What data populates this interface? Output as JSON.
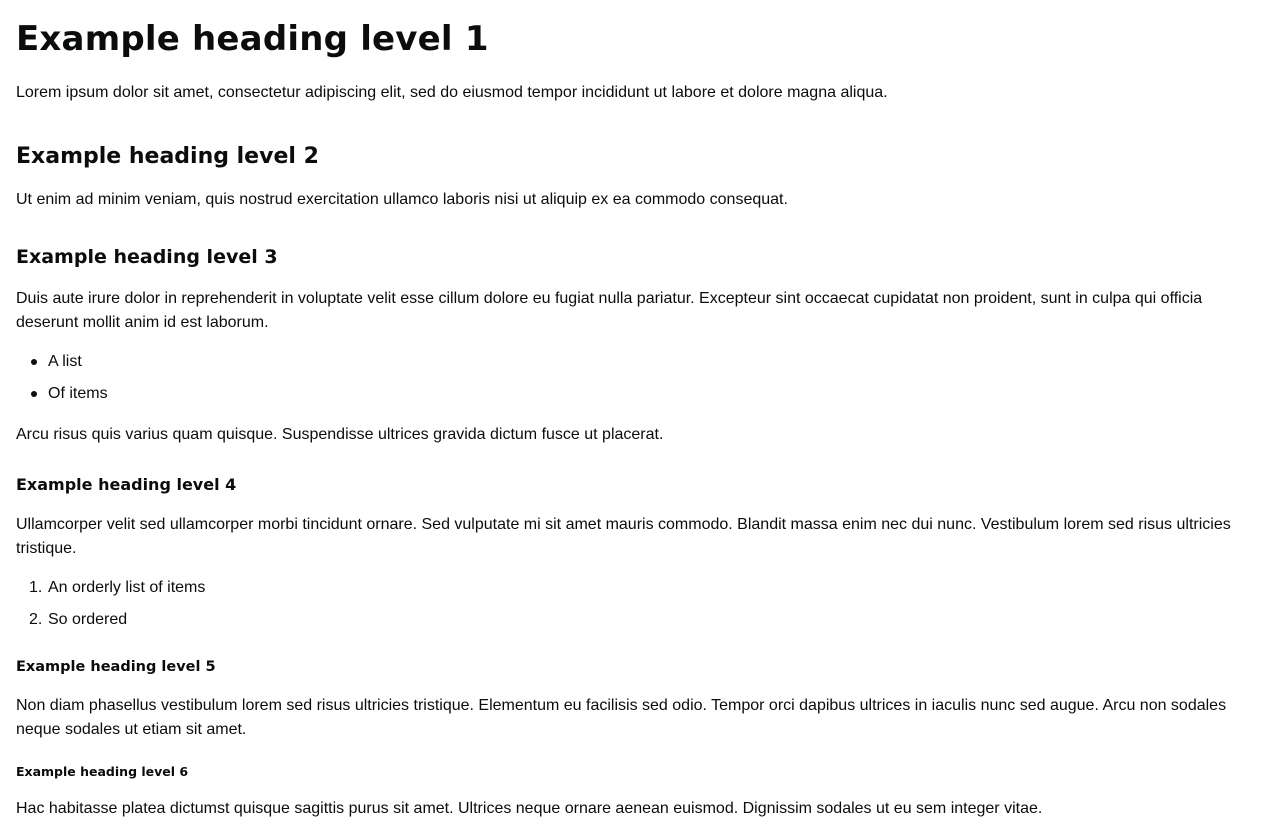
{
  "headings": {
    "h1": "Example heading level 1",
    "h2": "Example heading level 2",
    "h3": "Example heading level 3",
    "h4": "Example heading level 4",
    "h5": "Example heading level 5",
    "h6": "Example heading level 6"
  },
  "paragraphs": {
    "p1": "Lorem ipsum dolor sit amet, consectetur adipiscing elit, sed do eiusmod tempor incididunt ut labore et dolore magna aliqua.",
    "p2": "Ut enim ad minim veniam, quis nostrud exercitation ullamco laboris nisi ut aliquip ex ea commodo consequat.",
    "p3": "Duis aute irure dolor in reprehenderit in voluptate velit esse cillum dolore eu fugiat nulla pariatur. Excepteur sint occaecat cupidatat non proident, sunt in culpa qui officia deserunt mollit anim id est laborum.",
    "p4": "Arcu risus quis varius quam quisque. Suspendisse ultrices gravida dictum fusce ut placerat.",
    "p5": "Ullamcorper velit sed ullamcorper morbi tincidunt ornare. Sed vulputate mi sit amet mauris commodo. Blandit massa enim nec dui nunc. Vestibulum lorem sed risus ultricies tristique.",
    "p6": "Non diam phasellus vestibulum lorem sed risus ultricies tristique. Elementum eu facilisis sed odio. Tempor orci dapibus ultrices in iaculis nunc sed augue. Arcu non sodales neque sodales ut etiam sit amet.",
    "p7": "Hac habitasse platea dictumst quisque sagittis purus sit amet. Ultrices neque ornare aenean euismod. Dignissim sodales ut eu sem integer vitae."
  },
  "unordered_list": {
    "items": [
      "A list",
      "Of items"
    ]
  },
  "ordered_list": {
    "markers": [
      "1.",
      "2."
    ],
    "items": [
      "An orderly list of items",
      "So ordered"
    ]
  },
  "colors": {
    "text": "#0b0c0c",
    "background": "#ffffff"
  }
}
